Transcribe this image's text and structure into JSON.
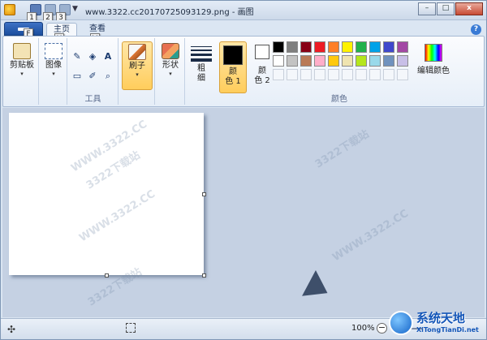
{
  "window": {
    "title": "www.3322.cc20170725093129.png - 画图",
    "minimize_label": "–",
    "maximize_label": "□",
    "close_label": "x"
  },
  "quick_access": {
    "dropdown_glyph": "▼",
    "keytips": [
      "1",
      "2",
      "3"
    ]
  },
  "tabs": {
    "file_keytip": "F",
    "home_label": "主页",
    "home_keytip": "H",
    "view_label": "查看",
    "view_keytip": "V",
    "help_glyph": "?"
  },
  "ribbon": {
    "clipboard": {
      "label": "剪贴板",
      "caret": "▾"
    },
    "image": {
      "label": "图像",
      "caret": "▾"
    },
    "tools": {
      "group_label": "工具",
      "pencil": "✎",
      "fill": "◈",
      "text": "A",
      "eraser": "▭",
      "picker": "✐",
      "magnifier": "⌕"
    },
    "brushes": {
      "label": "刷子",
      "caret": "▾"
    },
    "shapes": {
      "label": "形状",
      "caret": "▾"
    },
    "size": {
      "label_top": "粗",
      "label_bottom": "细",
      "caret": "▾"
    },
    "colors": {
      "group_label": "颜色",
      "color1_top": "颜",
      "color1_bottom": "色 1",
      "color2_top": "颜",
      "color2_bottom": "色 2",
      "color1_value": "#000000",
      "color2_value": "#ffffff",
      "edit_label": "编辑颜色",
      "palette_row1": [
        "#000000",
        "#7f7f7f",
        "#880015",
        "#ed1c24",
        "#ff7f27",
        "#fff200",
        "#22b14c",
        "#00a2e8",
        "#3f48cc",
        "#a349a4"
      ],
      "palette_row2": [
        "#ffffff",
        "#c3c3c3",
        "#b97a57",
        "#ffaec9",
        "#ffc90e",
        "#efe4b0",
        "#b5e61d",
        "#99d9ea",
        "#7092be",
        "#c8bfe7"
      ]
    }
  },
  "watermarks": [
    "WWW.3322.CC",
    "3322下载站",
    "WWW.3322.CC",
    "3322下载站",
    "WWW.3322.CC",
    "3322下载站"
  ],
  "status": {
    "move_glyph": "✣",
    "zoom": "100%",
    "zoom_out_glyph": "−"
  },
  "brand": {
    "title": "系统天地",
    "subtitle": "XiTongTianDi.net"
  }
}
